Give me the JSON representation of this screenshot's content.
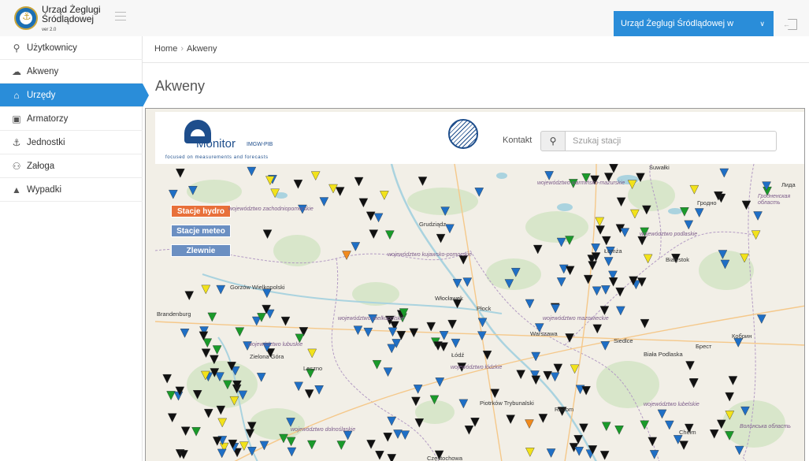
{
  "header": {
    "logo_line1": "Urząd Żeglugi",
    "logo_line2": "Śródlądowej",
    "version": "ver 2.0",
    "organization": "Urząd Żeglugi Śródlądowej w Szczecinie"
  },
  "sidebar": {
    "items": [
      {
        "label": "Użytkownicy",
        "icon": "user-icon"
      },
      {
        "label": "Akweny",
        "icon": "cloud-icon"
      },
      {
        "label": "Urzędy",
        "icon": "home-icon",
        "active": true
      },
      {
        "label": "Armatorzy",
        "icon": "briefcase-icon"
      },
      {
        "label": "Jednostki",
        "icon": "anchor-icon"
      },
      {
        "label": "Załoga",
        "icon": "users-icon"
      },
      {
        "label": "Wypadki",
        "icon": "warning-icon"
      }
    ]
  },
  "breadcrumb": {
    "home": "Home",
    "current": "Akweny"
  },
  "page": {
    "title": "Akweny"
  },
  "monitor": {
    "name": "Monitor",
    "suffix": "IMGW-PIB",
    "tagline": "focused on measurements and forecasts",
    "contact": "Kontakt",
    "search_placeholder": "Szukaj stacji"
  },
  "map": {
    "buttons": {
      "hydro": "Stacje hydro",
      "meteo": "Stacje meteo",
      "basins": "Zlewnie"
    },
    "regions": [
      "województwo warmińsko-mazurskie",
      "województwo zachodniopomorskie",
      "województwo kujawsko-pomorskie",
      "województwo wielkopolskie",
      "województwo lubuskie",
      "województwo mazowieckie",
      "województwo łódzkie",
      "województwo podlaskie",
      "województwo lubelskie",
      "województwo dolnośląskie",
      "Волинська область",
      "Гродненская область"
    ],
    "cities": [
      "Białystok",
      "Grudziądz",
      "Włocławek",
      "Płock",
      "Warszawa",
      "Siedlce",
      "Biała Podlaska",
      "Łódź",
      "Piotrków Trybunalski",
      "Radom",
      "Chełm",
      "Leszno",
      "Zielona Góra",
      "Gorzów Wielkopolski",
      "Łomża",
      "Suwałki",
      "Гродно",
      "Брест",
      "Кобрин",
      "Brandenburg",
      "Częstochowa",
      "Лида"
    ],
    "colors": {
      "hydro_blue": "#1f6fc5",
      "alarm_black": "#111111",
      "warn_yellow": "#f2e21b",
      "ok_green": "#1a9a2a",
      "orange": "#f08a1e"
    }
  }
}
